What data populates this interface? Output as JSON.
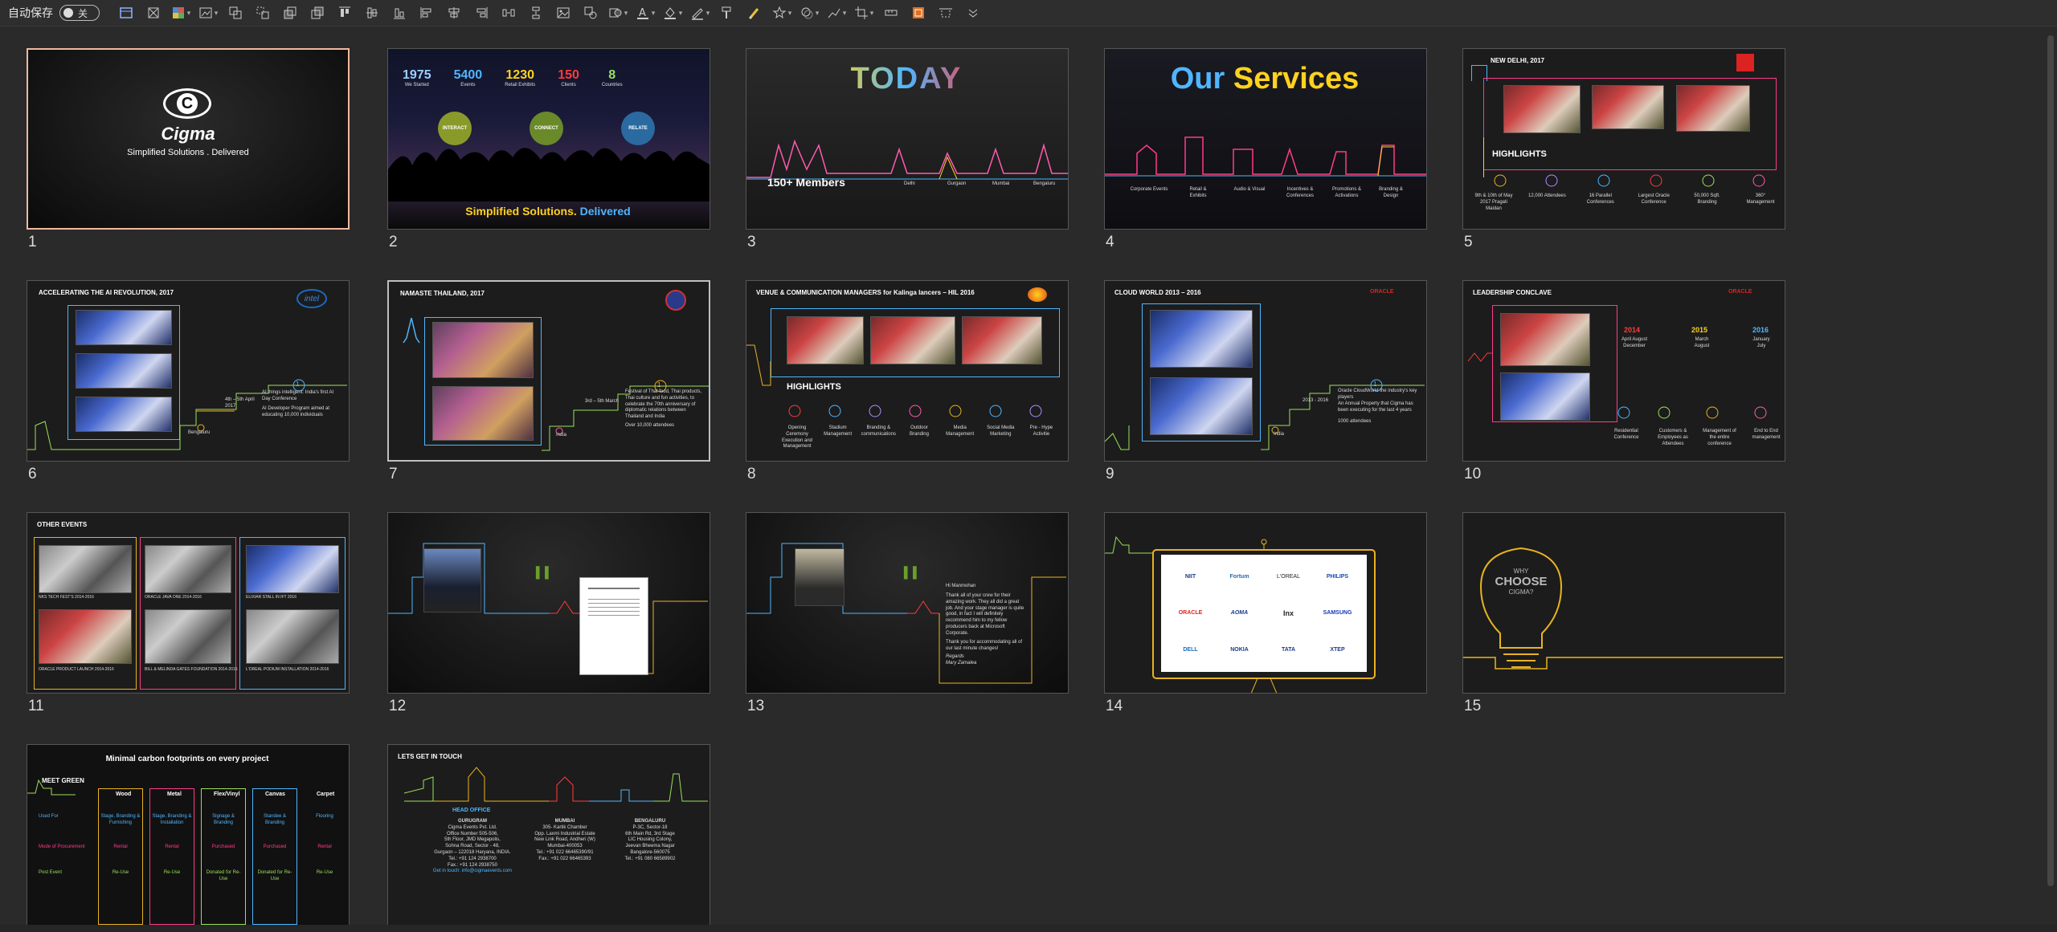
{
  "toolbar": {
    "autosave_label": "自动保存",
    "toggle_state": "关"
  },
  "slides": [
    {
      "n": "1",
      "brand": "Cigma",
      "tagline": "Simplified Solutions . Delivered",
      "logo": "C"
    },
    {
      "n": "2",
      "stats": [
        {
          "v": "1975",
          "l": "We Started",
          "c": "#9ad0ff"
        },
        {
          "v": "5400",
          "l": "Events",
          "c": "#4fb6ff"
        },
        {
          "v": "1230",
          "l": "Retail Exhibits",
          "c": "#ffd21f"
        },
        {
          "v": "150",
          "l": "Clients",
          "c": "#ff3b3b"
        },
        {
          "v": "8",
          "l": "Countries",
          "c": "#9be05a"
        }
      ],
      "circles": [
        {
          "t": "INTERACT",
          "c": "#8a9a2a"
        },
        {
          "t": "CONNECT",
          "c": "#6a8a2a"
        },
        {
          "t": "RELATE",
          "c": "#2a6aa0"
        }
      ],
      "footer_a": "Simplified Solutions.",
      "footer_b": "Delivered"
    },
    {
      "n": "3",
      "title": "TODAY",
      "members": "150+ Members",
      "cities": [
        "Delhi",
        "Gurgaon",
        "Mumbai",
        "Bengaluru"
      ]
    },
    {
      "n": "4",
      "title_a": "Our",
      "title_b": "Services",
      "items": [
        "Corporate Events",
        "Retail & Exhibits",
        "Audio & Visual",
        "Incentives & Conferences",
        "Promotions & Activations",
        "Branding & Design"
      ]
    },
    {
      "n": "5",
      "title": "NEW DELHI, 2017",
      "hl": "HIGHLIGHTS",
      "items": [
        "9th & 10th of May 2017 Pragati Maidan",
        "12,000 Attendees",
        "16 Parallel Conferences",
        "Largest Oracle Conference",
        "50,000 Sqft. Branding",
        "360° Management"
      ]
    },
    {
      "n": "6",
      "title": "ACCELERATING THE AI REVOLUTION, 2017",
      "logo": "intel",
      "date": "4th – 5th April 2017",
      "city": "Bengaluru",
      "step": "1",
      "p1": "AI things intelligent: India's first AI Day Conference",
      "p2": "AI Developer Program aimed at educating 10,000 individuals"
    },
    {
      "n": "7",
      "title": "NAMASTE THAILAND, 2017",
      "date": "3rd – 5th March",
      "city": "India",
      "step": "1",
      "p1": "Festival of Thai food, Thai products, Thai culture and fun activities, to celebrate the 70th anniversary of diplomatic relations between Thailand and India",
      "p2": "Over 10,000 attendees"
    },
    {
      "n": "8",
      "title": "VENUE & COMMUNICATION MANAGERS for Kalinga lancers – HIL 2016",
      "hl": "HIGHLIGHTS",
      "items": [
        "Opening Ceremony Execution and Management",
        "Stadium Management",
        "Branding & communications",
        "Outdoor Branding",
        "Media Management",
        "Social Media Marketing",
        "Pre - Hype Activitie"
      ]
    },
    {
      "n": "9",
      "title": "CLOUD WORLD 2013 – 2016",
      "logo": "ORACLE",
      "date": "2013 - 2016",
      "city": "India",
      "step": "1",
      "p1": "Oracle CloudWorld the industry's key players",
      "p2": "An Annual Property that Cigma has been executing for the last 4 years",
      "p3": "1000 attendees"
    },
    {
      "n": "10",
      "title": "LEADERSHIP CONCLAVE",
      "logo": "ORACLE",
      "years": [
        {
          "y": "2014",
          "c": "#ff3b3b",
          "d": "April August December"
        },
        {
          "y": "2015",
          "c": "#ffd21f",
          "d": "March August"
        },
        {
          "y": "2016",
          "c": "#4fb6ff",
          "d": "January July"
        }
      ],
      "items": [
        "Residential Conference",
        "Customers & Employees as Attendees",
        "Management of the entire conference",
        "End to End management"
      ]
    },
    {
      "n": "11",
      "title": "OTHER EVENTS",
      "caps": [
        "NKS TECH FEST'S 2014-2016",
        "ORACLE JAVA ONE 2014-2016",
        "ELIXIAR STALL IN IFT 2016",
        "ORACLE PRODUCT LAUNCH 2014-2016",
        "BILL & MELINDA GATES FOUNDATION 2014-2016",
        "L'OREAL PODIUM INSTALLATION 2014-2016"
      ]
    },
    {
      "n": "12"
    },
    {
      "n": "13",
      "letter": [
        "Hi Manmohan",
        "Thank all of your crew for their amazing work. They all did a great job. And your stage manager is quite good, in fact I will definitely recommend him to my fellow producers back at Microsoft Corporate.",
        "Thank you for accommodating all of our last minute changes!",
        "Regards",
        "Mary Zamalea"
      ]
    },
    {
      "n": "14",
      "logos": [
        "NIIT",
        "Fortum",
        "L'OREAL",
        "PHILIPS",
        "ORACLE",
        "AOMA",
        "Inx",
        "SAMSUNG",
        "DELL",
        "NOKIA",
        "TATA",
        "XTEP"
      ]
    },
    {
      "n": "15",
      "why": "WHY",
      "choose": "CHOOSE",
      "cigma": "CIGMA?"
    },
    {
      "n": "16",
      "title": "Minimal carbon footprints on every project",
      "meet": "MEET GREEN",
      "cols": [
        {
          "t": "Wood",
          "c": "#e8b320"
        },
        {
          "t": "Metal",
          "c": "#ff3b8a"
        },
        {
          "t": "Flex/Vinyl",
          "c": "#9be05a"
        },
        {
          "t": "Canvas",
          "c": "#4fb6ff"
        },
        {
          "t": "Carpet",
          "c": "#ff3b3b"
        }
      ],
      "rows": [
        "Used For",
        "Mode of Procurement",
        "Post Event"
      ],
      "cells": [
        [
          "Stage, Branding & Furnishing",
          "Stage, Branding & Installation",
          "Signage & Branding",
          "Standee & Branding",
          "Flooring"
        ],
        [
          "Rental",
          "Rental",
          "Purchased",
          "Purchased",
          "Rental"
        ],
        [
          "Re-Use",
          "Re-Use",
          "Donated for Re-Use",
          "Donated for Re-Use",
          "Re-Use"
        ]
      ]
    },
    {
      "n": "17",
      "title": "LETS GET IN TOUCH",
      "ho": "HEAD OFFICE",
      "offices": [
        {
          "city": "GURUGRAM",
          "lines": [
            "Cigma Events Pvt. Ltd.",
            "Office Number 505-506,",
            "5th Floor, JMD Megapolis,",
            "Sohna Road, Sector - 48,",
            "Gurgaon – 122018 Haryana, INDIA.",
            "Tel.: +91 124 2938700",
            "Fax.: +91 124 2938750",
            "Get in touch: info@cigmaevents.com"
          ]
        },
        {
          "city": "MUMBAI",
          "lines": [
            "305- Kartik Chamber",
            "Opp. Laxmi Industrial Estate",
            "New Link Road, Andheri (W)",
            "Mumbai-400053",
            "Tel.: +91 022 66465390/91",
            "Fax.: +91 022 66465393"
          ]
        },
        {
          "city": "BENGALURU",
          "lines": [
            "P-3C, Sector-18",
            "6th Main Rd, 3rd Stage",
            "LIC Housing Colony,",
            "Jeevan Bheema Nagar",
            "Bangalore-560075",
            "Tel.: +91 080 66589902"
          ]
        }
      ]
    }
  ]
}
